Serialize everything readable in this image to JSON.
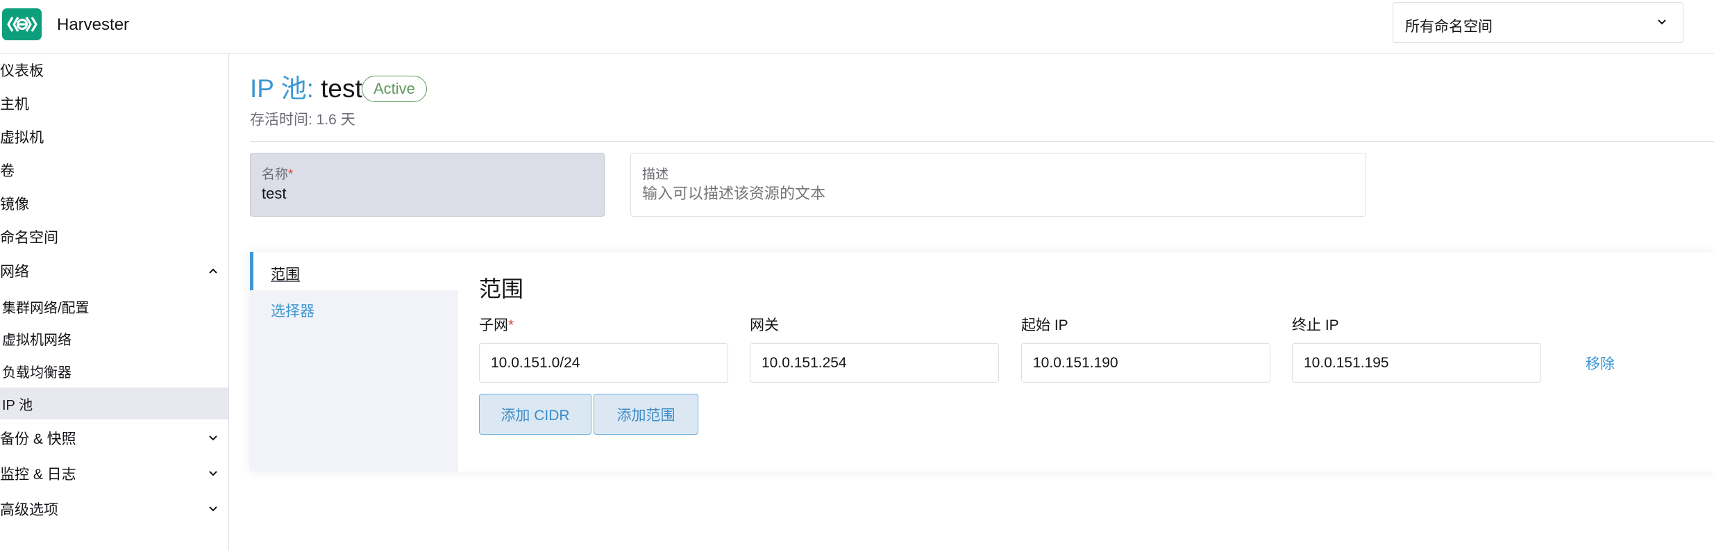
{
  "header": {
    "app_name": "Harvester",
    "namespace_select": {
      "value": "所有命名空间"
    }
  },
  "sidebar": {
    "items": [
      {
        "label": "仪表板"
      },
      {
        "label": "主机"
      },
      {
        "label": "虚拟机"
      },
      {
        "label": "卷"
      },
      {
        "label": "镜像"
      },
      {
        "label": "命名空间"
      },
      {
        "label": "网络",
        "expanded": true
      },
      {
        "label": "集群网络/配置"
      },
      {
        "label": "虚拟机网络"
      },
      {
        "label": "负载均衡器"
      },
      {
        "label": "IP 池",
        "active": true
      },
      {
        "label": "备份 & 快照",
        "expanded": false
      },
      {
        "label": "监控 & 日志",
        "expanded": false
      },
      {
        "label": "高级选项",
        "expanded": false
      }
    ]
  },
  "page": {
    "title_prefix": "IP 池:",
    "title_name": "test",
    "status_badge": "Active",
    "age": "存活时间: 1.6 天"
  },
  "form": {
    "name_label": "名称",
    "required_mark": "*",
    "name_value": "test",
    "description_label": "描述",
    "description_placeholder": "输入可以描述该资源的文本"
  },
  "tabs": [
    {
      "label": "范围",
      "active": true
    },
    {
      "label": "选择器",
      "active": false
    }
  ],
  "range_section": {
    "title": "范围",
    "columns": {
      "subnet": "子网",
      "gateway": "网关",
      "start_ip": "起始 IP",
      "end_ip": "终止 IP"
    },
    "row": {
      "subnet": "10.0.151.0/24",
      "gateway": "10.0.151.254",
      "start_ip": "10.0.151.190",
      "end_ip": "10.0.151.195",
      "remove_label": "移除"
    },
    "add_cidr_label": "添加 CIDR",
    "add_range_label": "添加范围"
  },
  "colors": {
    "accent": "#3d98d3",
    "logo": "#0d9f7c",
    "status_active": "#5d995d",
    "required": "#d9463c"
  }
}
